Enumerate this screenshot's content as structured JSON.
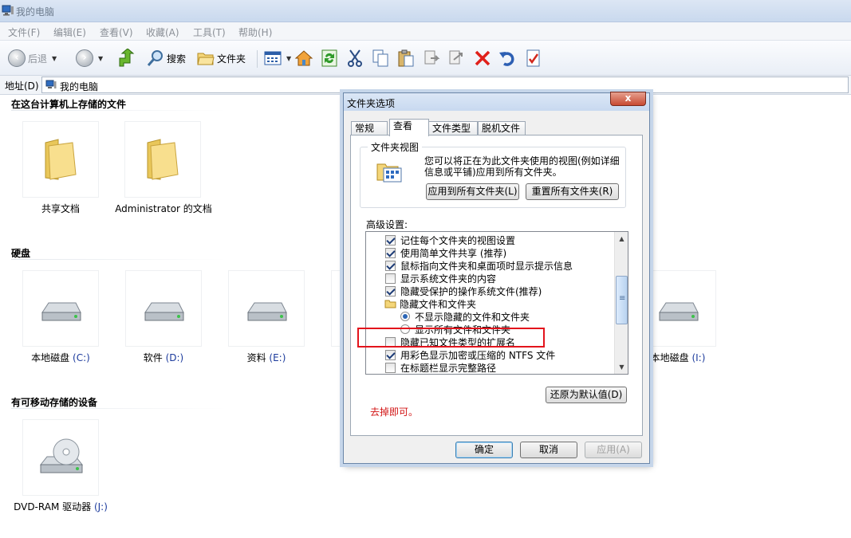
{
  "window": {
    "title": "我的电脑"
  },
  "menu": [
    "文件(F)",
    "编辑(E)",
    "查看(V)",
    "收藏(A)",
    "工具(T)",
    "帮助(H)"
  ],
  "toolbar": {
    "back": "后退",
    "search": "搜索",
    "folders": "文件夹"
  },
  "address": {
    "label": "地址(D)",
    "value": "我的电脑"
  },
  "groups": {
    "stored": {
      "title": "在这台计算机上存储的文件",
      "items": [
        "共享文档",
        "Administrator 的文档"
      ]
    },
    "drives": {
      "title": "硬盘",
      "items": [
        {
          "name": "本地磁盘",
          "letter": "(C:)"
        },
        {
          "name": "软件",
          "letter": "(D:)"
        },
        {
          "name": "资料",
          "letter": "(E:)"
        },
        {
          "name": "本地磁盘",
          "letter": "(I:)"
        }
      ]
    },
    "removable": {
      "title": "有可移动存储的设备",
      "items": [
        {
          "name": "DVD-RAM 驱动器",
          "letter": "(J:)"
        }
      ]
    }
  },
  "dialog": {
    "title": "文件夹选项",
    "close": "x",
    "tabs": [
      "常规",
      "查看",
      "文件类型",
      "脱机文件"
    ],
    "active_tab": "查看",
    "folder_views": {
      "legend": "文件夹视图",
      "description": "您可以将正在为此文件夹使用的视图(例如详细信息或平铺)应用到所有文件夹。",
      "apply_all": "应用到所有文件夹(L)",
      "reset_all": "重置所有文件夹(R)"
    },
    "advanced_label": "高级设置:",
    "settings": [
      {
        "type": "checkbox",
        "checked": true,
        "text": "记住每个文件夹的视图设置"
      },
      {
        "type": "checkbox",
        "checked": true,
        "text": "使用简单文件共享 (推荐)"
      },
      {
        "type": "checkbox",
        "checked": true,
        "text": "鼠标指向文件夹和桌面项时显示提示信息"
      },
      {
        "type": "checkbox",
        "checked": false,
        "text": "显示系统文件夹的内容"
      },
      {
        "type": "checkbox",
        "checked": true,
        "text": "隐藏受保护的操作系统文件(推荐)"
      },
      {
        "type": "folder",
        "checked": false,
        "text": "隐藏文件和文件夹"
      },
      {
        "type": "radio",
        "checked": true,
        "text": "不显示隐藏的文件和文件夹"
      },
      {
        "type": "radio",
        "checked": false,
        "text": "显示所有文件和文件夹"
      },
      {
        "type": "checkbox",
        "checked": false,
        "text": "隐藏已知文件类型的扩展名"
      },
      {
        "type": "checkbox",
        "checked": true,
        "text": "用彩色显示加密或压缩的 NTFS 文件"
      },
      {
        "type": "checkbox",
        "checked": false,
        "text": "在标题栏显示完整路径"
      }
    ],
    "restore_defaults": "还原为默认值(D)",
    "annotation": "去掉即可。",
    "ok": "确定",
    "cancel": "取消",
    "apply": "应用(A)"
  }
}
